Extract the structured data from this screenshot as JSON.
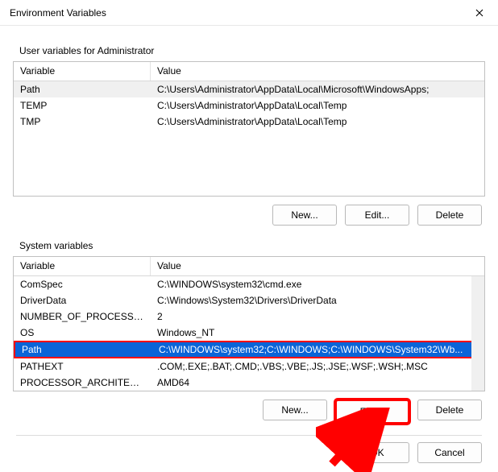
{
  "window": {
    "title": "Environment Variables"
  },
  "userGroup": {
    "label": "User variables for Administrator",
    "headers": {
      "variable": "Variable",
      "value": "Value"
    },
    "rows": [
      {
        "variable": "Path",
        "value": "C:\\Users\\Administrator\\AppData\\Local\\Microsoft\\WindowsApps;"
      },
      {
        "variable": "TEMP",
        "value": "C:\\Users\\Administrator\\AppData\\Local\\Temp"
      },
      {
        "variable": "TMP",
        "value": "C:\\Users\\Administrator\\AppData\\Local\\Temp"
      }
    ],
    "buttons": {
      "new": "New...",
      "edit": "Edit...",
      "delete": "Delete"
    }
  },
  "sysGroup": {
    "label": "System variables",
    "headers": {
      "variable": "Variable",
      "value": "Value"
    },
    "rows": [
      {
        "variable": "ComSpec",
        "value": "C:\\WINDOWS\\system32\\cmd.exe"
      },
      {
        "variable": "DriverData",
        "value": "C:\\Windows\\System32\\Drivers\\DriverData"
      },
      {
        "variable": "NUMBER_OF_PROCESSORS",
        "value": "2"
      },
      {
        "variable": "OS",
        "value": "Windows_NT"
      },
      {
        "variable": "Path",
        "value": "C:\\WINDOWS\\system32;C:\\WINDOWS;C:\\WINDOWS\\System32\\Wb..."
      },
      {
        "variable": "PATHEXT",
        "value": ".COM;.EXE;.BAT;.CMD;.VBS;.VBE;.JS;.JSE;.WSF;.WSH;.MSC"
      },
      {
        "variable": "PROCESSOR_ARCHITECTURE",
        "value": "AMD64"
      }
    ],
    "selectedIndex": 4,
    "buttons": {
      "new": "New...",
      "edit": "Edit...",
      "delete": "Delete"
    }
  },
  "footer": {
    "ok": "OK",
    "cancel": "Cancel"
  }
}
